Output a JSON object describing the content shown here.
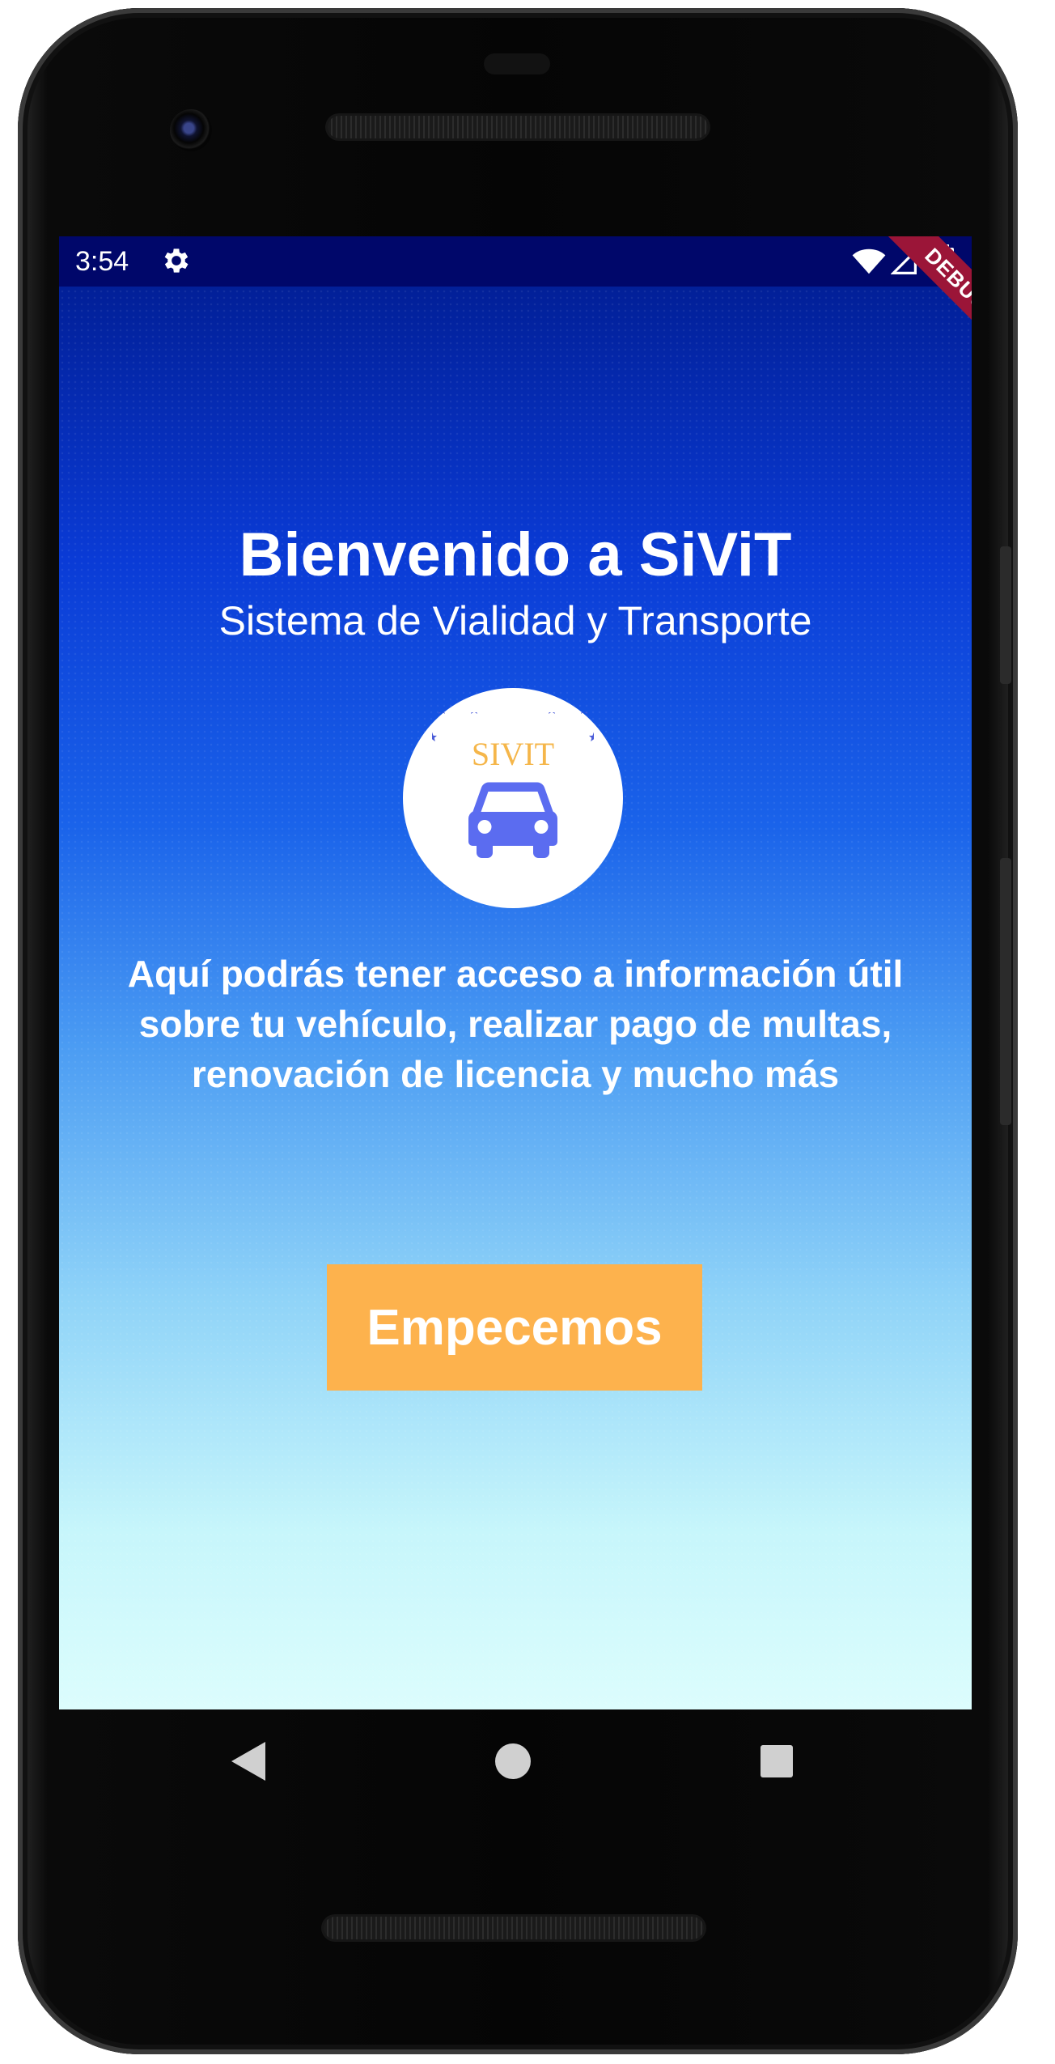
{
  "status_bar": {
    "time": "3:54",
    "debug_label": "DEBUG"
  },
  "welcome": {
    "title": "Bienvenido a SiViT",
    "subtitle": "Sistema de Vialidad y Transporte",
    "logo_text": "SIVIT",
    "description": "Aquí podrás tener acceso a información útil sobre tu vehículo, realizar pago de multas, renovación de licencia y mucho más",
    "start_button_label": "Empecemos"
  },
  "colors": {
    "status_bar": "#00076a",
    "gradient_top": "#001a8c",
    "gradient_bottom": "#dcfdfd",
    "button": "#fdb24d",
    "logo_text": "#f5b64a",
    "car": "#5b6cf0",
    "debug_ribbon": "#9b1538"
  },
  "icons": {
    "status_settings": "gear-icon",
    "wifi": "wifi-icon",
    "signal": "signal-icon",
    "battery": "battery-icon",
    "logo_car": "car-icon",
    "nav_back": "back-triangle-icon",
    "nav_home": "home-circle-icon",
    "nav_recent": "recent-square-icon"
  }
}
